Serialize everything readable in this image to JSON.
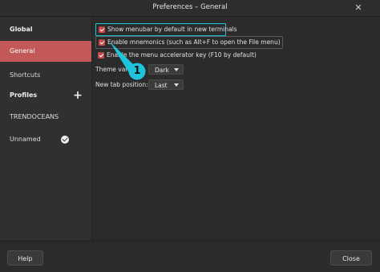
{
  "window": {
    "title": "Preferences – General",
    "close_glyph": "✕"
  },
  "sidebar": {
    "section_global": "Global",
    "item_general": "General",
    "item_shortcuts": "Shortcuts",
    "section_profiles": "Profiles",
    "add_glyph": "+",
    "profile_1": "TRENDOCEANS",
    "profile_2": "Unnamed"
  },
  "options": {
    "show_menubar": {
      "label": "Show menubar by default in new terminals",
      "checked": true
    },
    "enable_mnemonics": {
      "label": "Enable mnemonics (such as Alt+F to open the File menu)",
      "checked": true
    },
    "enable_accel": {
      "label": "Enable the menu accelerator key (F10 by default)",
      "checked": true
    }
  },
  "form": {
    "theme_label": "Theme variant:",
    "theme_value": "Dark",
    "tab_label": "New tab position:",
    "tab_value": "Last"
  },
  "footer": {
    "help": "Help",
    "close": "Close"
  },
  "annotation": {
    "number": "1",
    "color": "#1ec4dc"
  },
  "colors": {
    "accent": "#c25858",
    "highlight": "#1ec4dc"
  }
}
